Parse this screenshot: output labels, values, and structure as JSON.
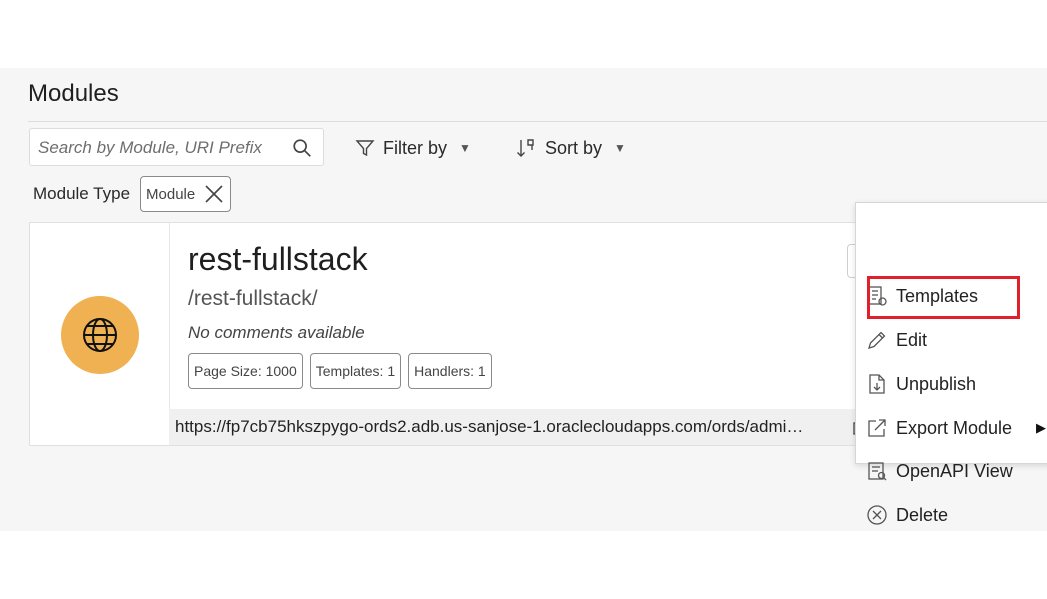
{
  "page": {
    "title": "Modules"
  },
  "search": {
    "placeholder": "Search by Module, URI Prefix"
  },
  "toolbar": {
    "filter_label": "Filter by",
    "sort_label": "Sort by"
  },
  "filters": {
    "label": "Module Type",
    "chip": "Module"
  },
  "module_card": {
    "name": "rest-fullstack",
    "uri_prefix": "/rest-fullstack/",
    "comment": "No comments available",
    "stats": {
      "page_size": "Page Size: 1000",
      "templates": "Templates: 1",
      "handlers": "Handlers: 1"
    },
    "url": "https://fp7cb75hkszpygo-ords2.adb.us-sanjose-1.oraclecloudapps.com/ords/admi…"
  },
  "context_menu": {
    "items": [
      {
        "label": "Templates",
        "icon": "templates-icon",
        "highlighted": true
      },
      {
        "label": "Edit",
        "icon": "pencil-icon"
      },
      {
        "label": "Unpublish",
        "icon": "unpublish-icon"
      },
      {
        "label": "Export Module",
        "icon": "export-icon",
        "has_submenu": true
      },
      {
        "label": "OpenAPI View",
        "icon": "openapi-icon"
      },
      {
        "label": "Delete",
        "icon": "delete-icon"
      }
    ]
  },
  "colors": {
    "avatar": "#f0b152",
    "highlight": "#e0202a",
    "panel_bg": "#f6f6f6"
  }
}
